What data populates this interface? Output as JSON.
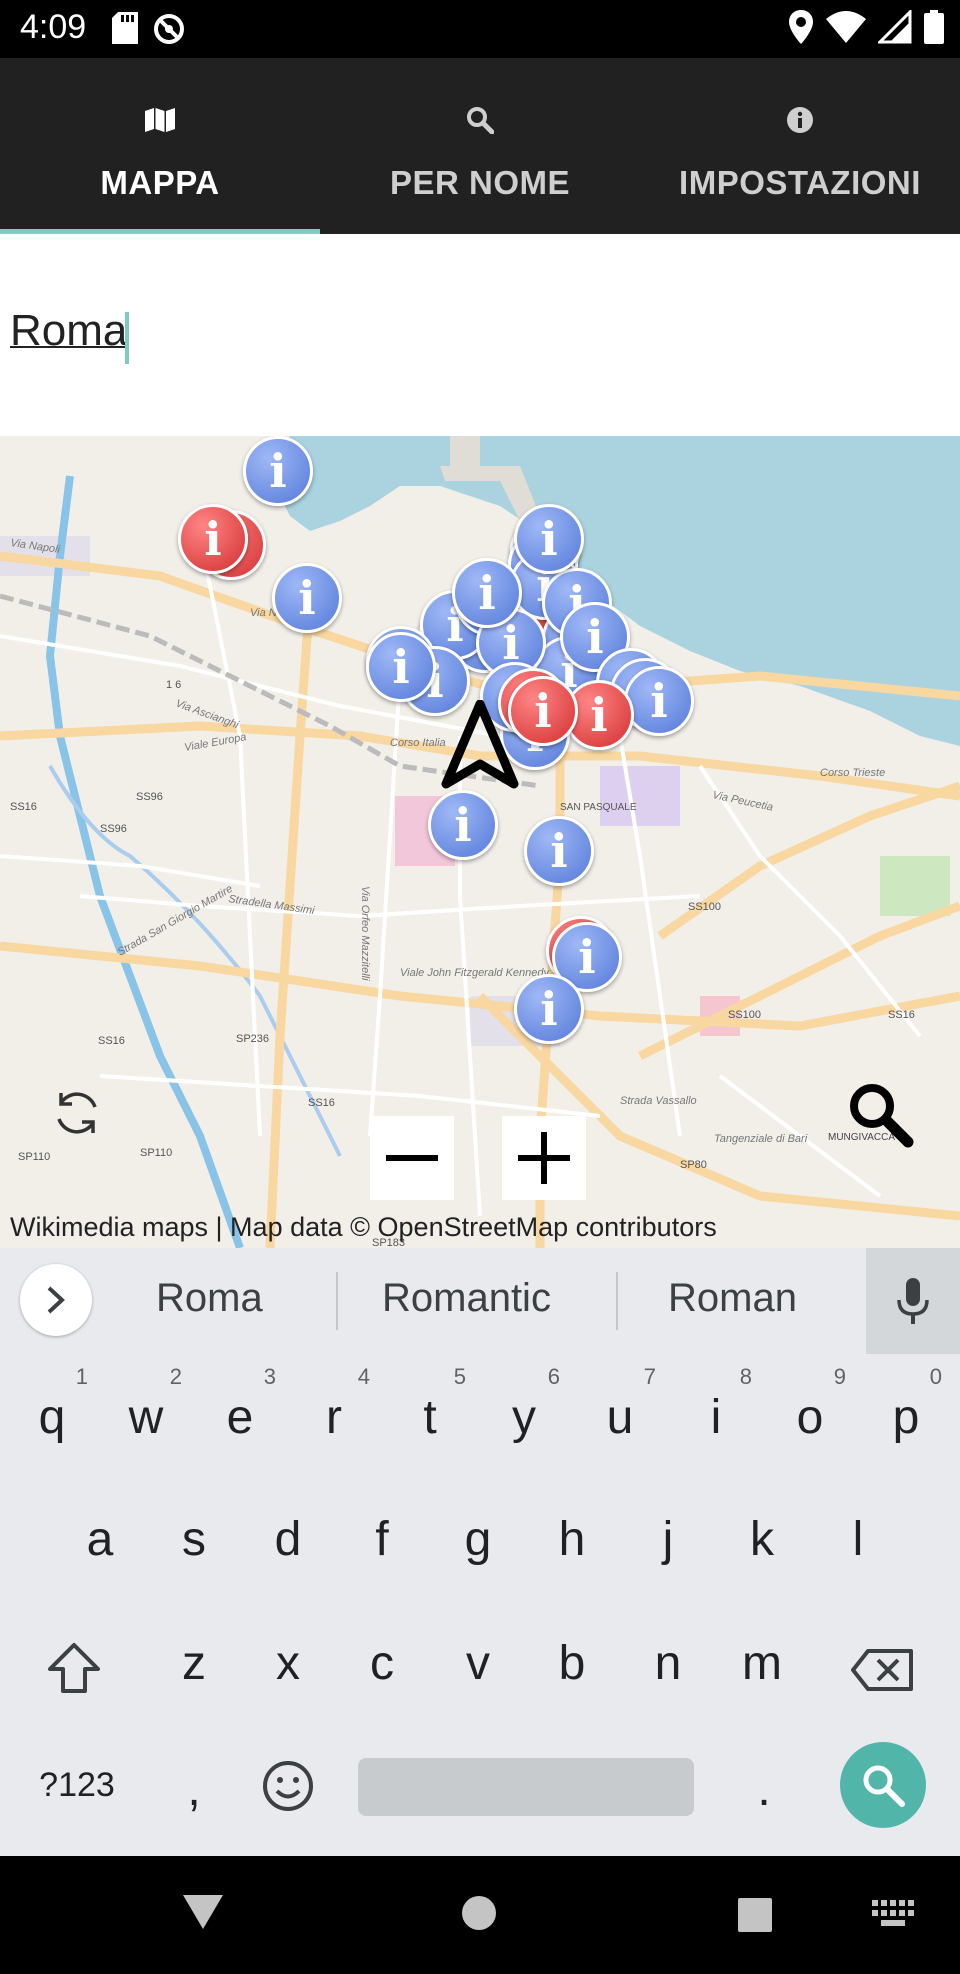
{
  "status_bar": {
    "time": "4:09",
    "left_icons": [
      "sd-card-icon",
      "sync-off-icon"
    ],
    "right_icons": [
      "location-icon",
      "wifi-icon",
      "signal-icon",
      "battery-icon"
    ]
  },
  "tabs": [
    {
      "label": "MAPPA",
      "icon": "map-icon",
      "active": true
    },
    {
      "label": "PER NOME",
      "icon": "search-icon",
      "active": false
    },
    {
      "label": "IMPOSTAZIONI",
      "icon": "info-icon",
      "active": false
    }
  ],
  "search": {
    "value": "Roma"
  },
  "map": {
    "attribution": "Wikimedia maps | Map data © OpenStreetMap contributors",
    "place_labels": [
      "Via Napoli",
      "Viale Europa",
      "Via Ascianghi",
      "Corso Trieste",
      "Via Peucetia",
      "SAN PASQUALE",
      "Strada San Giorgio Martire",
      "Stradella Massimi",
      "Viale John Fitzgerald Kennedy",
      "Via Orfeo Mazzitelli",
      "Strada Vassallo",
      "Tangenziale di Bari",
      "MUNGIVACCA",
      "SS16",
      "SS96",
      "SS100",
      "SP236",
      "SP110",
      "SP80",
      "SP183",
      "Corso Italia"
    ],
    "marker_symbol": "i",
    "controls": {
      "refresh": "refresh-icon",
      "search": "search-icon",
      "zoom_out": "minus-icon",
      "zoom_in": "plus-icon"
    }
  },
  "keyboard": {
    "suggestions": [
      "Roma",
      "Romantic",
      "Roman"
    ],
    "row1": [
      {
        "key": "q",
        "hint": "1"
      },
      {
        "key": "w",
        "hint": "2"
      },
      {
        "key": "e",
        "hint": "3"
      },
      {
        "key": "r",
        "hint": "4"
      },
      {
        "key": "t",
        "hint": "5"
      },
      {
        "key": "y",
        "hint": "6"
      },
      {
        "key": "u",
        "hint": "7"
      },
      {
        "key": "i",
        "hint": "8"
      },
      {
        "key": "o",
        "hint": "9"
      },
      {
        "key": "p",
        "hint": "0"
      }
    ],
    "row2": [
      "a",
      "s",
      "d",
      "f",
      "g",
      "h",
      "j",
      "k",
      "l"
    ],
    "row3": [
      "z",
      "x",
      "c",
      "v",
      "b",
      "n",
      "m"
    ],
    "symbols_key": "?123",
    "comma_key": ",",
    "period_key": "."
  },
  "colors": {
    "accent": "#80cbc4",
    "tabbar": "#212121",
    "search_key": "#52b5a9",
    "marker_blue": "#5479d8",
    "marker_red": "#d32f2f"
  }
}
